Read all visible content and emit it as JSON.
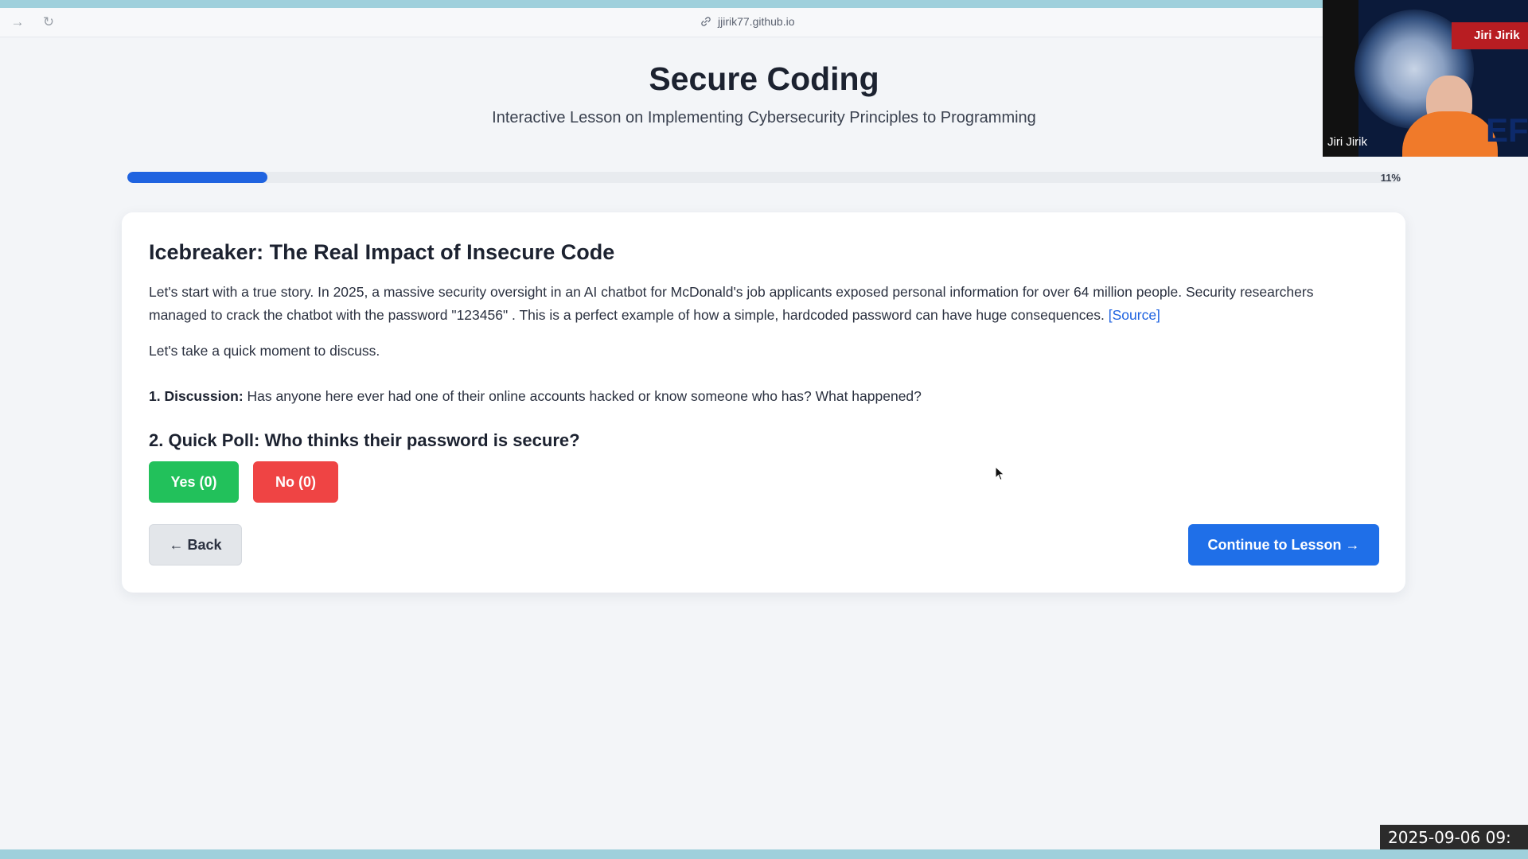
{
  "browser": {
    "url": "jjirik77.github.io",
    "icons": {
      "forward": "forward-arrow-icon",
      "reload": "reload-icon",
      "link": "link-icon"
    }
  },
  "header": {
    "title": "Secure Coding",
    "subtitle": "Interactive Lesson on Implementing Cybersecurity Principles to Programming"
  },
  "progress": {
    "percent": 11,
    "label": "11%"
  },
  "lesson": {
    "title": "Icebreaker: The Real Impact of Insecure Code",
    "intro_text": "Let's start with a true story. In 2025, a massive security oversight in an AI chatbot for McDonald's job applicants exposed personal information for over 64 million people. Security researchers managed to crack the chatbot with the password \"123456\" . This is a perfect example of how a simple, hardcoded password can have huge consequences.",
    "source_link": "[Source]",
    "discuss_prompt": "Let's take a quick moment to discuss.",
    "discussion_label": "1. Discussion:",
    "discussion_text": "Has anyone here ever had one of their online accounts hacked or know someone who has? What happened?",
    "poll_title": "2. Quick Poll: Who thinks their password is secure?",
    "yes_button": "Yes (0)",
    "no_button": "No (0)",
    "back_button": "← Back",
    "continue_button": "Continue to Lesson →"
  },
  "video_overlay": {
    "name_banner": "Jiri Jirik",
    "name_caption": "Jiri Jirik",
    "logo_text": "EF"
  },
  "timestamp": "2025-09-06 09:",
  "colors": {
    "accent_blue": "#1f63e0",
    "yes_green": "#22c15b",
    "no_red": "#ef4444",
    "background": "#f3f5f8"
  }
}
